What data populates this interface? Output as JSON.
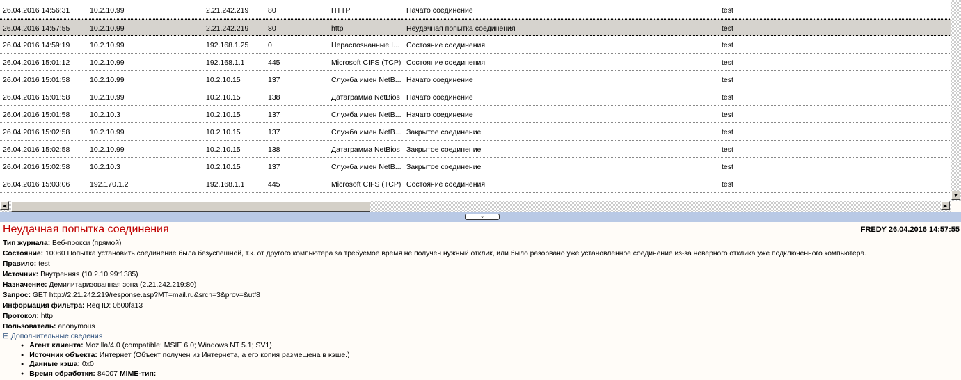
{
  "rows": [
    [
      "26.04.2016 14:56:31",
      "10.2.10.99",
      "2.21.242.219",
      "80",
      "HTTP",
      "Начато соединение",
      "test"
    ],
    [
      "26.04.2016 14:57:55",
      "10.2.10.99",
      "2.21.242.219",
      "80",
      "http",
      "Неудачная попытка соединения",
      "test"
    ],
    [
      "26.04.2016 14:59:19",
      "10.2.10.99",
      "192.168.1.25",
      "0",
      "Нераспознанные I...",
      "Состояние соединения",
      "test"
    ],
    [
      "26.04.2016 15:01:12",
      "10.2.10.99",
      "192.168.1.1",
      "445",
      "Microsoft CIFS (TCP)",
      "Состояние соединения",
      "test"
    ],
    [
      "26.04.2016 15:01:58",
      "10.2.10.99",
      "10.2.10.15",
      "137",
      "Служба имен NetB...",
      "Начато соединение",
      "test"
    ],
    [
      "26.04.2016 15:01:58",
      "10.2.10.99",
      "10.2.10.15",
      "138",
      "Датаграмма NetBios",
      "Начато соединение",
      "test"
    ],
    [
      "26.04.2016 15:01:58",
      "10.2.10.3",
      "10.2.10.15",
      "137",
      "Служба имен NetB...",
      "Начато соединение",
      "test"
    ],
    [
      "26.04.2016 15:02:58",
      "10.2.10.99",
      "10.2.10.15",
      "137",
      "Служба имен NetB...",
      "Закрытое соединение",
      "test"
    ],
    [
      "26.04.2016 15:02:58",
      "10.2.10.99",
      "10.2.10.15",
      "138",
      "Датаграмма NetBios",
      "Закрытое соединение",
      "test"
    ],
    [
      "26.04.2016 15:02:58",
      "10.2.10.3",
      "10.2.10.15",
      "137",
      "Служба имен NetB...",
      "Закрытое соединение",
      "test"
    ],
    [
      "26.04.2016 15:03:06",
      "192.170.1.2",
      "192.168.1.1",
      "445",
      "Microsoft CIFS (TCP)",
      "Состояние соединения",
      "test"
    ]
  ],
  "selected_row": 1,
  "detail": {
    "title": "Неудачная попытка соединения",
    "stamp": "FREDY 26.04.2016 14:57:55",
    "fields": [
      {
        "label": "Тип журнала:",
        "value": "Веб-прокси (прямой)"
      },
      {
        "label": "Состояние:",
        "value": "10060 Попытка установить соединение была безуспешной, т.к. от другого компьютера за требуемое время не получен нужный отклик, или было разорвано уже установленное соединение из-за неверного отклика уже подключенного компьютера."
      },
      {
        "label": "Правило:",
        "value": "test"
      },
      {
        "label": "Источник:",
        "value": "Внутренняя (10.2.10.99:1385)"
      },
      {
        "label": "Назначение:",
        "value": "Демилитаризованная зона (2.21.242.219:80)"
      },
      {
        "label": "Запрос:",
        "value": "GET http://2.21.242.219/response.asp?MT=mail.ru&srch=3&prov=&utf8"
      },
      {
        "label": "Информация фильтра:",
        "value": "Req ID: 0b00fa13"
      },
      {
        "label": "Протокол:",
        "value": "http"
      },
      {
        "label": "Пользователь:",
        "value": "anonymous"
      }
    ],
    "more_label": "Дополнительные сведения",
    "more": [
      {
        "label": "Агент клиента:",
        "value": "Mozilla/4.0 (compatible; MSIE 6.0; Windows NT 5.1; SV1)"
      },
      {
        "label": "Источник объекта:",
        "value": "Интернет (Объект получен из Интернета, а его копия размещена в кэше.)"
      },
      {
        "label": "Данные кэша:",
        "value": "0x0"
      },
      {
        "label": "Время обработки:",
        "value": "84007",
        "extra": "MIME-тип:"
      }
    ]
  }
}
